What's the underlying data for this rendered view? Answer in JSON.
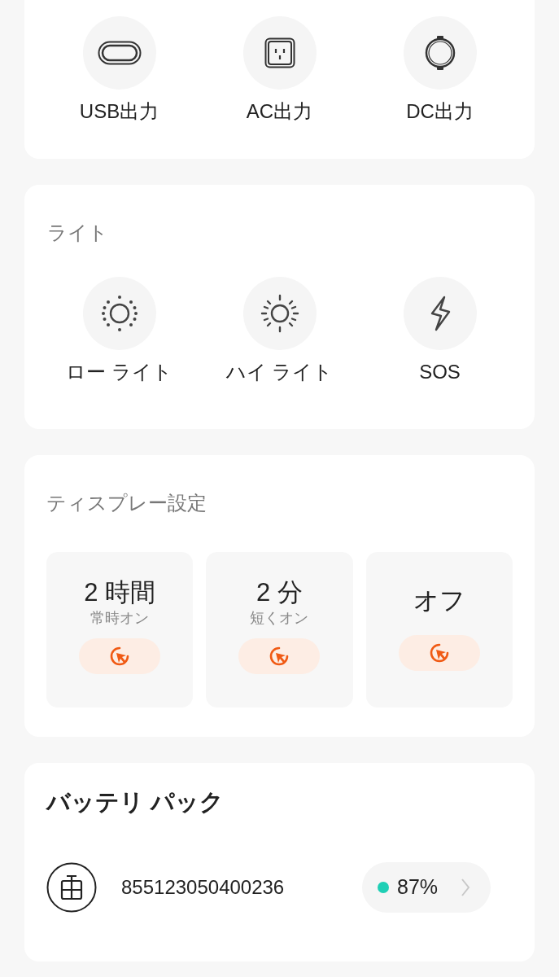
{
  "outputs": [
    {
      "kind": "usb",
      "label": "USB出力"
    },
    {
      "kind": "ac",
      "label": "AC出力"
    },
    {
      "kind": "dc",
      "label": "DC出力"
    }
  ],
  "light": {
    "title": "ライト",
    "items": [
      {
        "kind": "low",
        "label": "ロー ライト"
      },
      {
        "kind": "high",
        "label": "ハイ ライト"
      },
      {
        "kind": "sos",
        "label": "SOS"
      }
    ]
  },
  "display": {
    "title": "ティスプレー設定",
    "options": [
      {
        "value": "2 時間",
        "caption": "常時オン"
      },
      {
        "value": "2 分",
        "caption": "短くオン"
      },
      {
        "value": "オフ"
      }
    ]
  },
  "battery_pack": {
    "title": "バッテリ パック",
    "packs": [
      {
        "serial": "855123050400236",
        "charge": "87%",
        "color": "#1fcfb5"
      }
    ]
  }
}
